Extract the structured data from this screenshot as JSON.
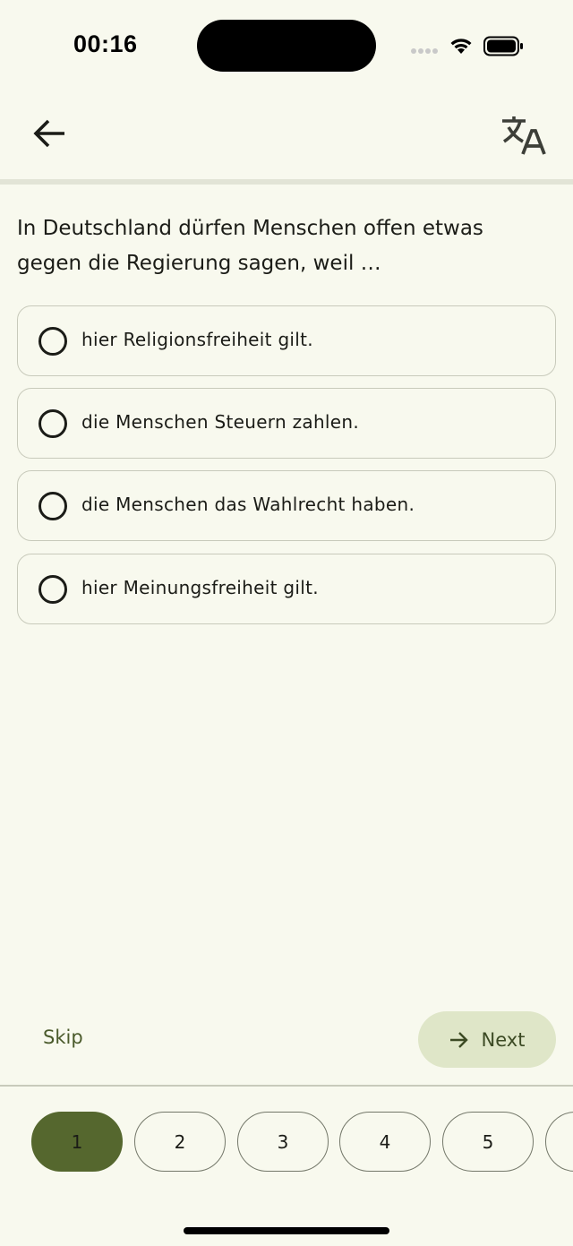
{
  "status": {
    "time": "00:16"
  },
  "app_bar": {
    "back_icon": "arrow-left-icon",
    "translate_icon": "translate-icon"
  },
  "progress": {
    "fraction": 0.0
  },
  "question": {
    "text": "In Deutschland dürfen Menschen offen etwas gegen die Regierung sagen, weil …"
  },
  "options": [
    {
      "label": "hier Religionsfreiheit gilt."
    },
    {
      "label": "die Menschen Steuern zahlen."
    },
    {
      "label": "die Menschen das Wahlrecht haben."
    },
    {
      "label": "hier Meinungsfreiheit gilt."
    }
  ],
  "actions": {
    "skip_label": "Skip",
    "next_label": "Next"
  },
  "pager": {
    "pages": [
      "1",
      "2",
      "3",
      "4",
      "5"
    ],
    "current": "1"
  },
  "colors": {
    "background": "#f8f9ee",
    "accent": "#55672e",
    "next_button": "#dfe6c8"
  }
}
